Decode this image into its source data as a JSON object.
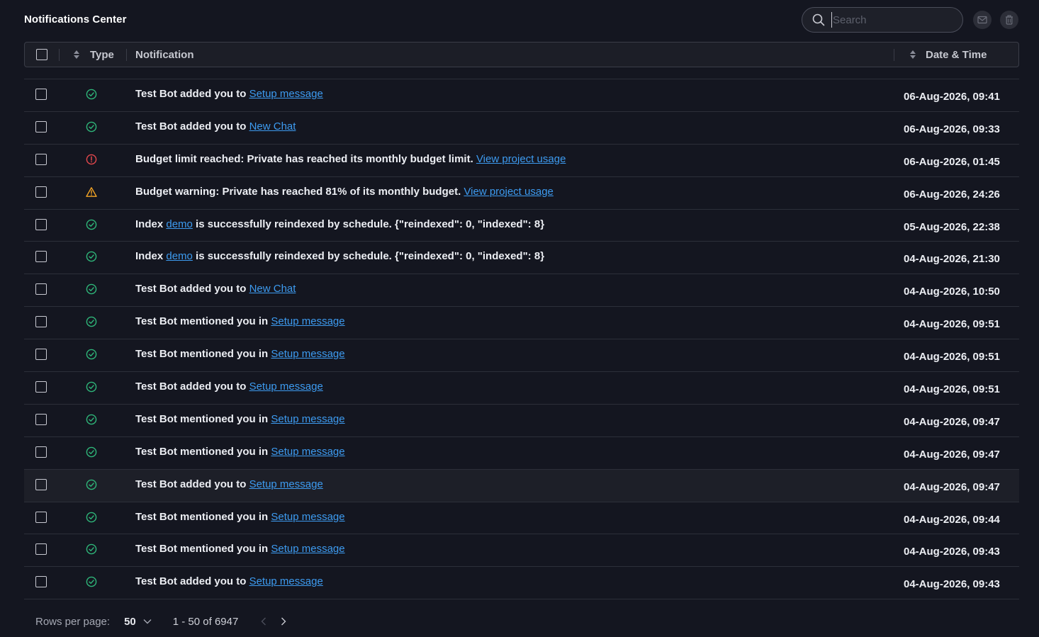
{
  "header": {
    "title": "Notifications Center",
    "search_placeholder": "Search"
  },
  "table": {
    "columns": {
      "type": "Type",
      "notification": "Notification",
      "datetime": "Date & Time"
    },
    "rows": [
      {
        "type": "success",
        "text": "Test Bot added you to ",
        "link": "Setup message",
        "after": "",
        "date": "06-Aug-2026, 09:41"
      },
      {
        "type": "success",
        "text": "Test Bot added you to ",
        "link": "New Chat",
        "after": "",
        "date": "06-Aug-2026, 09:33"
      },
      {
        "type": "error",
        "text": "Budget limit reached: Private has reached its monthly budget limit. ",
        "link": "View project usage",
        "after": "",
        "date": "06-Aug-2026, 01:45"
      },
      {
        "type": "warning",
        "text": "Budget warning: Private has reached 81% of its monthly budget. ",
        "link": "View project usage",
        "after": "",
        "date": "06-Aug-2026, 24:26"
      },
      {
        "type": "success",
        "text": "Index ",
        "link": "demo",
        "after": " is successfully reindexed by schedule. {\"reindexed\": 0, \"indexed\": 8}",
        "date": "05-Aug-2026, 22:38"
      },
      {
        "type": "success",
        "text": "Index ",
        "link": "demo",
        "after": " is successfully reindexed by schedule. {\"reindexed\": 0, \"indexed\": 8}",
        "date": "04-Aug-2026, 21:30"
      },
      {
        "type": "success",
        "text": "Test Bot added you to ",
        "link": "New Chat",
        "after": "",
        "date": "04-Aug-2026, 10:50"
      },
      {
        "type": "success",
        "text": "Test Bot mentioned you in ",
        "link": "Setup message",
        "after": "",
        "date": "04-Aug-2026, 09:51"
      },
      {
        "type": "success",
        "text": "Test Bot mentioned you in ",
        "link": "Setup message",
        "after": "",
        "date": "04-Aug-2026, 09:51"
      },
      {
        "type": "success",
        "text": "Test Bot added you to ",
        "link": "Setup message",
        "after": "",
        "date": "04-Aug-2026, 09:51"
      },
      {
        "type": "success",
        "text": "Test Bot mentioned you in ",
        "link": "Setup message",
        "after": "",
        "date": "04-Aug-2026, 09:47"
      },
      {
        "type": "success",
        "text": "Test Bot mentioned you in ",
        "link": "Setup message",
        "after": "",
        "date": "04-Aug-2026, 09:47"
      },
      {
        "type": "success",
        "text": "Test Bot added you to ",
        "link": "Setup message",
        "after": "",
        "date": "04-Aug-2026, 09:47"
      },
      {
        "type": "success",
        "text": "Test Bot mentioned you in ",
        "link": "Setup message",
        "after": "",
        "date": "04-Aug-2026, 09:44"
      },
      {
        "type": "success",
        "text": "Test Bot mentioned you in ",
        "link": "Setup message",
        "after": "",
        "date": "04-Aug-2026, 09:43"
      },
      {
        "type": "success",
        "text": "Test Bot added you to ",
        "link": "Setup message",
        "after": "",
        "date": "04-Aug-2026, 09:43"
      }
    ]
  },
  "footer": {
    "rows_per_page_label": "Rows per page:",
    "rows_per_page_value": "50",
    "range": "1 - 50 of 6947"
  },
  "colors": {
    "success": "#2fb77a",
    "error": "#e5484d",
    "warning": "#f5a524",
    "link": "#3d9bf0"
  }
}
